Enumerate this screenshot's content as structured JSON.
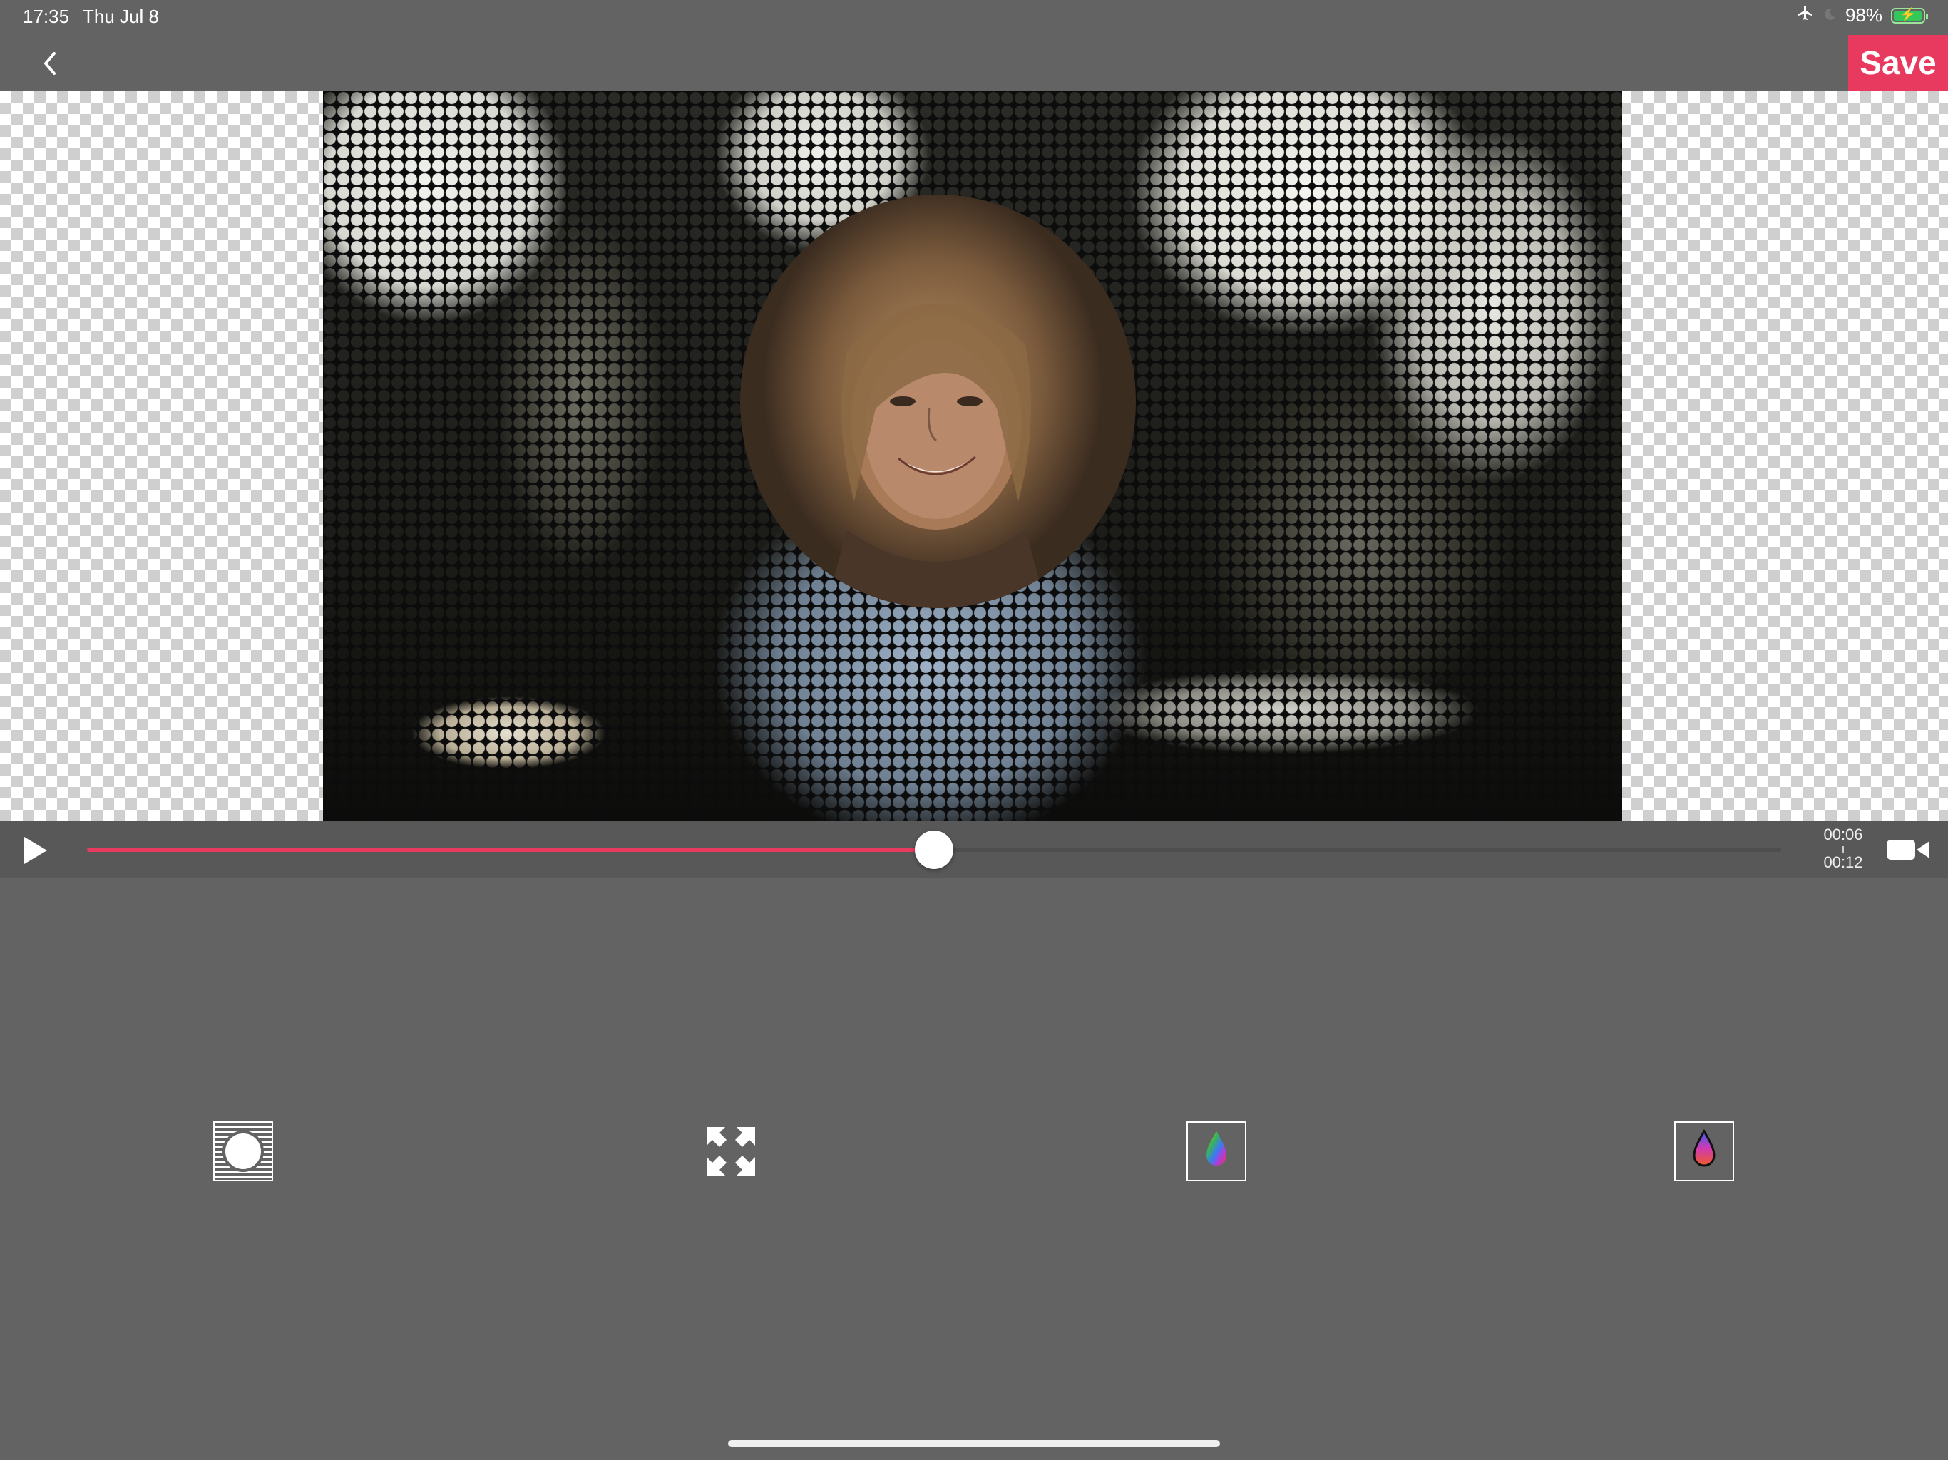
{
  "status_bar": {
    "time": "17:35",
    "date": "Thu Jul 8",
    "battery_percent": "98%",
    "battery_level": 0.98,
    "icons": [
      "airplane-mode-icon",
      "do-not-disturb-moon-icon",
      "battery-charging-icon"
    ]
  },
  "nav": {
    "back_icon": "chevron-left-icon",
    "save_label": "Save"
  },
  "colors": {
    "accent": "#e8395f",
    "background": "#636363",
    "playback_bar": "#585858"
  },
  "playback": {
    "current_time": "00:06",
    "total_time": "00:12",
    "progress": 0.5,
    "play_icon": "play-icon",
    "camera_icon": "video-camera-icon"
  },
  "tools": [
    {
      "name": "circle-pattern-tool",
      "icon": "striped-circle-icon"
    },
    {
      "name": "expand-tool",
      "icon": "expand-arrows-icon"
    },
    {
      "name": "color-tool-a",
      "icon": "rainbow-drop-icon"
    },
    {
      "name": "color-tool-b",
      "icon": "gradient-drop-icon"
    }
  ]
}
